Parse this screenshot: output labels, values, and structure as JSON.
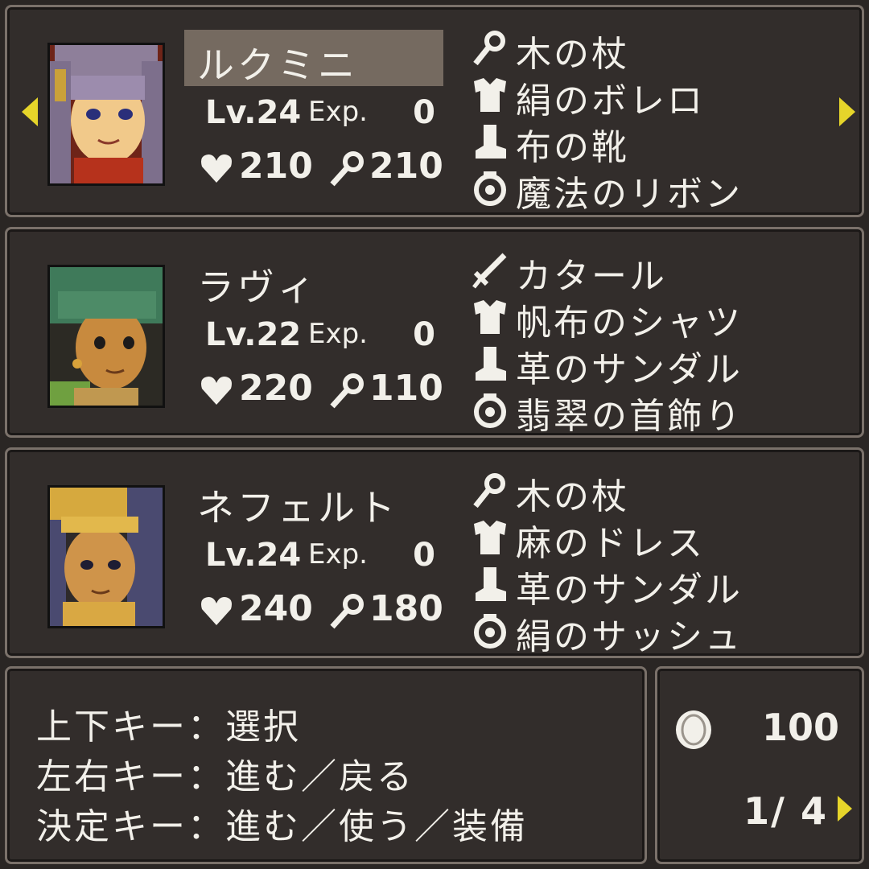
{
  "accent_color": "#e6d52a",
  "characters": [
    {
      "name": "ルクミニ",
      "selected": true,
      "level": "Lv.24",
      "exp_label": "Exp.",
      "exp": "0",
      "hp": "210",
      "mp": "210",
      "equipment": [
        {
          "icon": "staff-icon",
          "label": "木の杖"
        },
        {
          "icon": "armor-icon",
          "label": "絹のボレロ"
        },
        {
          "icon": "boot-icon",
          "label": "布の靴"
        },
        {
          "icon": "accessory-icon",
          "label": "魔法のリボン"
        }
      ]
    },
    {
      "name": "ラヴィ",
      "selected": false,
      "level": "Lv.22",
      "exp_label": "Exp.",
      "exp": "0",
      "hp": "220",
      "mp": "110",
      "equipment": [
        {
          "icon": "sword-icon",
          "label": "カタール"
        },
        {
          "icon": "armor-icon",
          "label": "帆布のシャツ"
        },
        {
          "icon": "boot-icon",
          "label": "革のサンダル"
        },
        {
          "icon": "accessory-icon",
          "label": "翡翠の首飾り"
        }
      ]
    },
    {
      "name": "ネフェルト",
      "selected": false,
      "level": "Lv.24",
      "exp_label": "Exp.",
      "exp": "0",
      "hp": "240",
      "mp": "180",
      "equipment": [
        {
          "icon": "staff-icon",
          "label": "木の杖"
        },
        {
          "icon": "armor-icon",
          "label": "麻のドレス"
        },
        {
          "icon": "boot-icon",
          "label": "革のサンダル"
        },
        {
          "icon": "accessory-icon",
          "label": "絹のサッシュ"
        }
      ]
    }
  ],
  "help": {
    "line1": "上下キー：選択",
    "line2": "左右キー：進む／戻る",
    "line3": "決定キー：進む／使う／装備"
  },
  "gold": {
    "icon": "coin-icon",
    "amount": "100"
  },
  "page": {
    "text": "1/ 4"
  }
}
